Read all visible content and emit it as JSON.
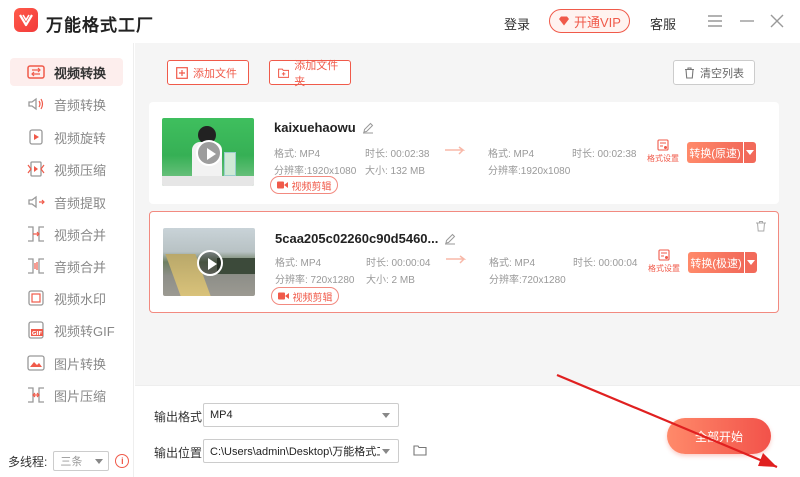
{
  "app": {
    "title": "万能格式工厂",
    "login_label": "登录",
    "vip_label": "开通VIP",
    "service_label": "客服"
  },
  "sidebar": {
    "items": [
      {
        "label": "视频转换",
        "icon": "video-convert-icon",
        "active": true
      },
      {
        "label": "音频转换",
        "icon": "audio-convert-icon"
      },
      {
        "label": "视频旋转",
        "icon": "video-rotate-icon"
      },
      {
        "label": "视频压缩",
        "icon": "video-compress-icon"
      },
      {
        "label": "音频提取",
        "icon": "audio-extract-icon"
      },
      {
        "label": "视频合并",
        "icon": "video-merge-icon"
      },
      {
        "label": "音频合并",
        "icon": "audio-merge-icon"
      },
      {
        "label": "视频水印",
        "icon": "video-watermark-icon"
      },
      {
        "label": "视频转GIF",
        "icon": "video-gif-icon"
      },
      {
        "label": "图片转换",
        "icon": "image-convert-icon"
      },
      {
        "label": "图片压缩",
        "icon": "image-compress-icon"
      }
    ],
    "threads_label": "多线程:",
    "threads_value": "三条"
  },
  "toolbar": {
    "add_file": "添加文件",
    "add_folder": "添加文件夹",
    "clear_list": "清空列表"
  },
  "files": [
    {
      "name": "kaixuehaowu",
      "src_format": "格式: MP4",
      "src_duration": "时长: 00:02:38",
      "src_resolution": "分辨率:1920x1080",
      "src_size": "大小: 132 MB",
      "dst_format": "格式: MP4",
      "dst_duration": "时长: 00:02:38",
      "dst_resolution": "分辨率:1920x1080",
      "edit_label": "视频剪辑",
      "format_settings": "格式设置",
      "convert_label": "转换(原速)"
    },
    {
      "name": "5caa205c02260c90d5460...",
      "src_format": "格式: MP4",
      "src_duration": "时长: 00:00:04",
      "src_resolution": "分辨率: 720x1280",
      "src_size": "大小: 2 MB",
      "dst_format": "格式: MP4",
      "dst_duration": "时长: 00:00:04",
      "dst_resolution": "分辨率:720x1280",
      "edit_label": "视频剪辑",
      "format_settings": "格式设置",
      "convert_label": "转换(极速)"
    }
  ],
  "output": {
    "format_label": "输出格式",
    "format_value": "MP4",
    "location_label": "输出位置",
    "location_value": "C:\\Users\\admin\\Desktop\\万能格式工厂",
    "start_all": "全部开始"
  },
  "colors": {
    "accent": "#f05a4a",
    "active_bg": "#fdeeed"
  }
}
